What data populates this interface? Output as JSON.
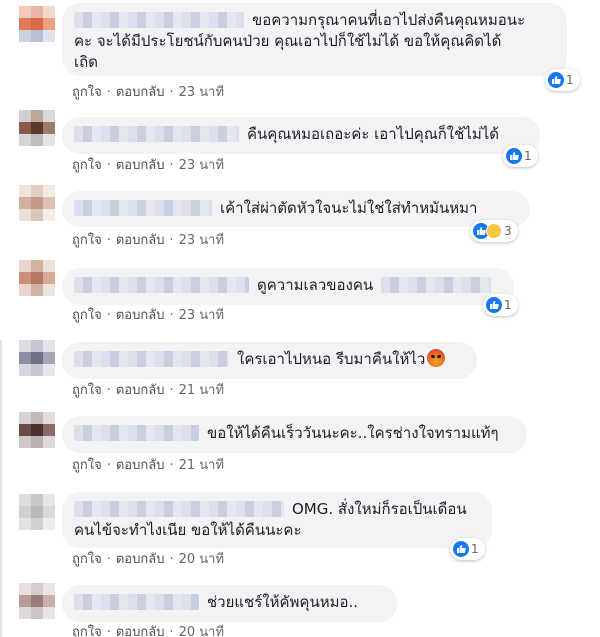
{
  "comments": [
    {
      "text_line1": "ขอความกรุณาคนที่เอาไปส่งคืนคุณหมอนะ",
      "text_line2": "คะ จะได้มีประโยชน์กับคนป่วย คุณเอาไปก็ใช้ไม่ได้ ขอให้คุณคิดได้",
      "text_line3": "เถิด",
      "like_label": "ถูกใจ",
      "reply_label": "ตอบกลับ",
      "time": "23 นาที",
      "reaction_count": "1"
    },
    {
      "text_line1": "คืนคุณหมอเถอะค่ะ เอาไปคุณก็ใช้ไม่ได้",
      "like_label": "ถูกใจ",
      "reply_label": "ตอบกลับ",
      "time": "23 นาที",
      "reaction_count": "1"
    },
    {
      "text_line1": "เค้าใส่ผ่าตัดหัวใจนะไม่ใช่ใส่ทำหมันหมา",
      "like_label": "ถูกใจ",
      "reply_label": "ตอบกลับ",
      "time": "23 นาที",
      "reaction_count": "3"
    },
    {
      "text_line1": "ดูความเลวของคน",
      "like_label": "ถูกใจ",
      "reply_label": "ตอบกลับ",
      "time": "23 นาที",
      "reaction_count": "1"
    },
    {
      "text_line1": "ใครเอาไปหนอ รีบมาคืนให้ไว",
      "like_label": "ถูกใจ",
      "reply_label": "ตอบกลับ",
      "time": "21 นาที"
    },
    {
      "text_line1": "ขอให้ได้คืนเร็ววันนะคะ..ใครช่างใจทรามแท้ๆ",
      "like_label": "ถูกใจ",
      "reply_label": "ตอบกลับ",
      "time": "21 นาที"
    },
    {
      "text_line1": "OMG. สั่งใหม่ก็รอเป็นเดือน",
      "text_line2": "คนไข้จะทำไงเนีย ขอให้ได้คืนนะคะ",
      "like_label": "ถูกใจ",
      "reply_label": "ตอบกลับ",
      "time": "20 นาที",
      "reaction_count": "1"
    },
    {
      "text_line1": "ช่วยแชร์ให้คัพคุนหมอ..",
      "like_label": "ถูกใจ",
      "reply_label": "ตอบกลับ",
      "time": "20 นาที"
    }
  ],
  "colors": {
    "bubble": "#f2f3f5",
    "like_blue": "#1877f2",
    "meta_text": "#606770"
  },
  "icons": {
    "like": "like-icon",
    "haha": "haha-icon",
    "angry": "angry-emoji-icon"
  }
}
